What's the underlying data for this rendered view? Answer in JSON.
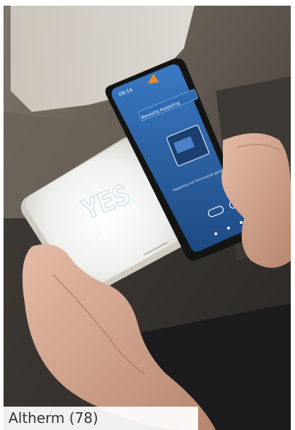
{
  "caption": "Altherm (78)",
  "thermostat": {
    "display_text": "YES"
  },
  "phone": {
    "status_time": "09:14",
    "header_button": "Bevestig Koppeling",
    "body_text": "Koppeling met thermostaat gelukt. Druk op de knoppen om te bevestigen."
  },
  "colors": {
    "phone_screen": "#2a5c9c",
    "thermostat_body": "#e8e6de",
    "display_glow": "#f6fbff",
    "skin": "#d9ad96",
    "wall": "#5b5149"
  }
}
